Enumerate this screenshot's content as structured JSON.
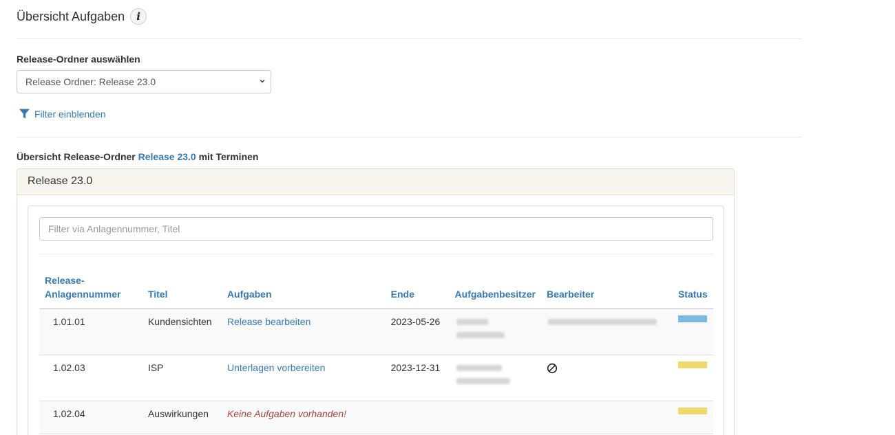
{
  "header": {
    "title": "Übersicht Aufgaben",
    "info_icon": "info-icon"
  },
  "release_select": {
    "label": "Release-Ordner auswählen",
    "selected": "Release Ordner: Release 23.0"
  },
  "filter_toggle": {
    "label": "Filter einblenden",
    "icon": "filter-icon"
  },
  "overview": {
    "prefix": "Übersicht Release-Ordner",
    "release_link": "Release 23.0",
    "suffix": "mit Terminen"
  },
  "panel": {
    "heading": "Release 23.0",
    "filter_placeholder": "Filter via Anlagennummer, Titel",
    "columns": [
      "Release-Anlagennummer",
      "Titel",
      "Aufgaben",
      "Ende",
      "Aufgabenbesitzer",
      "Bearbeiter",
      "Status"
    ],
    "column_label_release_line1": "Release-",
    "column_label_release_line2": "Anlagennummer",
    "rows": [
      {
        "nummer": "1.01.01",
        "titel": "Kundensichten",
        "aufgabe": "Release bearbeiten",
        "ende": "2023-05-26",
        "status_color": "#7ab8e2"
      },
      {
        "nummer": "1.02.03",
        "titel": "ISP",
        "aufgabe": "Unterlagen vorbereiten",
        "ende": "2023-12-31",
        "status_color": "#f2d96e"
      },
      {
        "nummer": "1.02.04",
        "titel": "Auswirkungen",
        "aufgabe": "Keine Aufgaben vorhanden!",
        "ende": "",
        "status_color": "#f2d96e"
      }
    ]
  },
  "colors": {
    "link": "#337ab7",
    "empty_tasks": "#a94442"
  }
}
